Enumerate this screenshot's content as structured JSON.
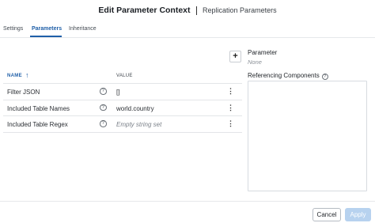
{
  "dialog": {
    "title": "Edit Parameter Context",
    "subtitle": "Replication Parameters"
  },
  "tabs": [
    {
      "label": "Settings",
      "active": false
    },
    {
      "label": "Parameters",
      "active": true
    },
    {
      "label": "Inheritance",
      "active": false
    }
  ],
  "table": {
    "col_name": "NAME",
    "sort_icon": "arrow-up-icon",
    "col_value": "VALUE",
    "rows": [
      {
        "name": "Filter JSON",
        "value": "[]",
        "empty": false
      },
      {
        "name": "Included Table Names",
        "value": "world.country",
        "empty": false
      },
      {
        "name": "Included Table Regex",
        "value": "Empty string set",
        "empty": true
      }
    ]
  },
  "details": {
    "parameter_label": "Parameter",
    "parameter_value": "None",
    "referencing_label": "Referencing Components"
  },
  "footer": {
    "cancel_label": "Cancel",
    "apply_label": "Apply"
  },
  "colors": {
    "accent": "#1f5fa8",
    "apply_disabled": "#b7d2ef"
  }
}
